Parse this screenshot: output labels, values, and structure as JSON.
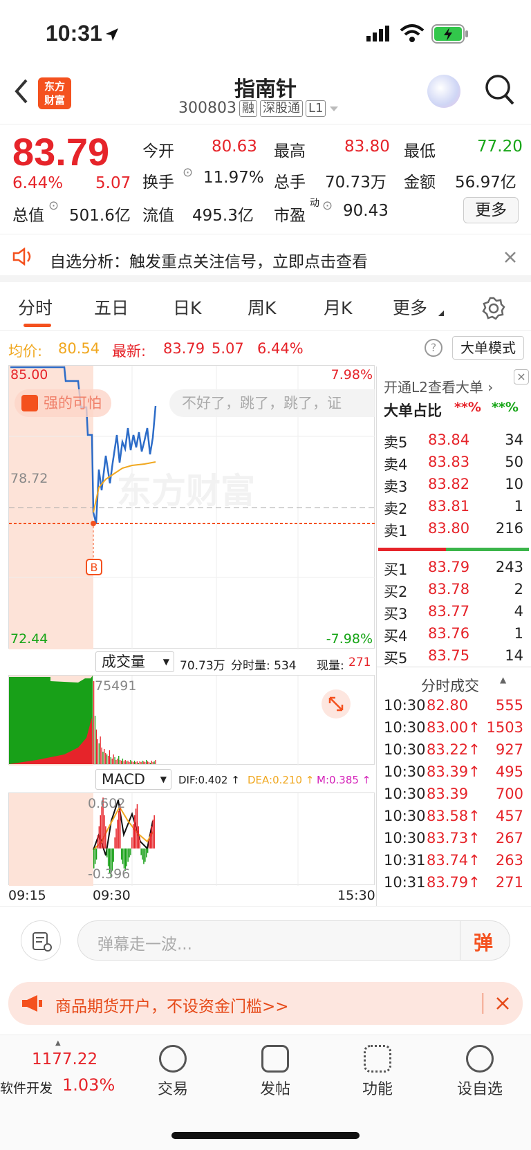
{
  "status_bar": {
    "time": "10:31"
  },
  "header": {
    "logo_line1": "东方",
    "logo_line2": "财富",
    "title": "指南针",
    "code": "300803",
    "tags": [
      "融",
      "深股通",
      "L1"
    ]
  },
  "quote": {
    "price": "83.79",
    "change_pct": "6.44%",
    "change": "5.07",
    "open_label": "今开",
    "open": "80.63",
    "high_label": "最高",
    "high": "83.80",
    "low_label": "最低",
    "low": "77.20",
    "turnover_label": "换手",
    "turnover": "11.97%",
    "volume_label": "总手",
    "volume": "70.73万",
    "amount_label": "金额",
    "amount": "56.97亿",
    "mktcap_label": "总值",
    "mktcap": "501.6亿",
    "float_label": "流值",
    "float": "495.3亿",
    "pe_label": "市盈",
    "pe_sup": "动",
    "pe": "90.43",
    "more": "更多"
  },
  "notice": {
    "text": "自选分析：触发重点关注信号，立即点击查看"
  },
  "tabs": [
    "分时",
    "五日",
    "日K",
    "周K",
    "月K",
    "更多"
  ],
  "info": {
    "avg_label": "均价:",
    "avg": "80.54",
    "latest_label": "最新:",
    "latest": "83.79",
    "chg": "5.07",
    "pct": "6.44%",
    "big_order_mode": "大单模式"
  },
  "chart": {
    "top_price": "85.00",
    "top_pct": "7.98%",
    "mid_price": "78.72",
    "bottom_price": "72.44",
    "bottom_pct": "-7.98%",
    "bubble1": "强的可怕",
    "bubble2": "不好了，跳了，跳了，证",
    "buy_marker": "B",
    "watermark": "东方财富",
    "vol_label": "成交量",
    "vol_info1": "70.73万",
    "vol_info2": "分时量: 534",
    "vol_info3": "现量:",
    "vol_info4": "271",
    "vol_max": "75491",
    "macd_label": "MACD",
    "dif": "DIF:0.402 ↑",
    "dea": "DEA:0.210 ↑",
    "m": "M:0.385 ↑",
    "macd_max": "0.602",
    "macd_min": "-0.396",
    "t_start": "09:15",
    "t_open": "09:30",
    "t_end": "15:30"
  },
  "orderbook": {
    "l2_link": "开通L2查看大单 ›",
    "big_ratio": "大单占比",
    "ratio_red": "**%",
    "ratio_green": "**%",
    "asks": [
      [
        "卖5",
        "83.84",
        "34"
      ],
      [
        "卖4",
        "83.83",
        "50"
      ],
      [
        "卖3",
        "83.82",
        "10"
      ],
      [
        "卖2",
        "83.81",
        "1"
      ],
      [
        "卖1",
        "83.80",
        "216"
      ]
    ],
    "bids": [
      [
        "买1",
        "83.79",
        "243"
      ],
      [
        "买2",
        "83.78",
        "2"
      ],
      [
        "买3",
        "83.77",
        "4"
      ],
      [
        "买4",
        "83.76",
        "1"
      ],
      [
        "买5",
        "83.75",
        "14"
      ]
    ]
  },
  "ticks": {
    "header": "分时成交",
    "rows": [
      [
        "10:30",
        "82.80",
        "555"
      ],
      [
        "10:30",
        "83.00↑",
        "1503"
      ],
      [
        "10:30",
        "83.22↑",
        "927"
      ],
      [
        "10:30",
        "83.39↑",
        "495"
      ],
      [
        "10:30",
        "83.39",
        "700"
      ],
      [
        "10:30",
        "83.58↑",
        "457"
      ],
      [
        "10:30",
        "83.73↑",
        "267"
      ],
      [
        "10:31",
        "83.74↑",
        "263"
      ],
      [
        "10:31",
        "83.79↑",
        "271"
      ]
    ]
  },
  "danmu": {
    "placeholder": "弹幕走一波...",
    "btn": "弹"
  },
  "banner": {
    "text": "商品期货开户，不设资金门槛>>"
  },
  "nav": {
    "index_value": "1177.22",
    "index_name": "软件开发",
    "index_pct": "1.03%",
    "items": [
      "交易",
      "发帖",
      "功能",
      "设自选"
    ]
  }
}
